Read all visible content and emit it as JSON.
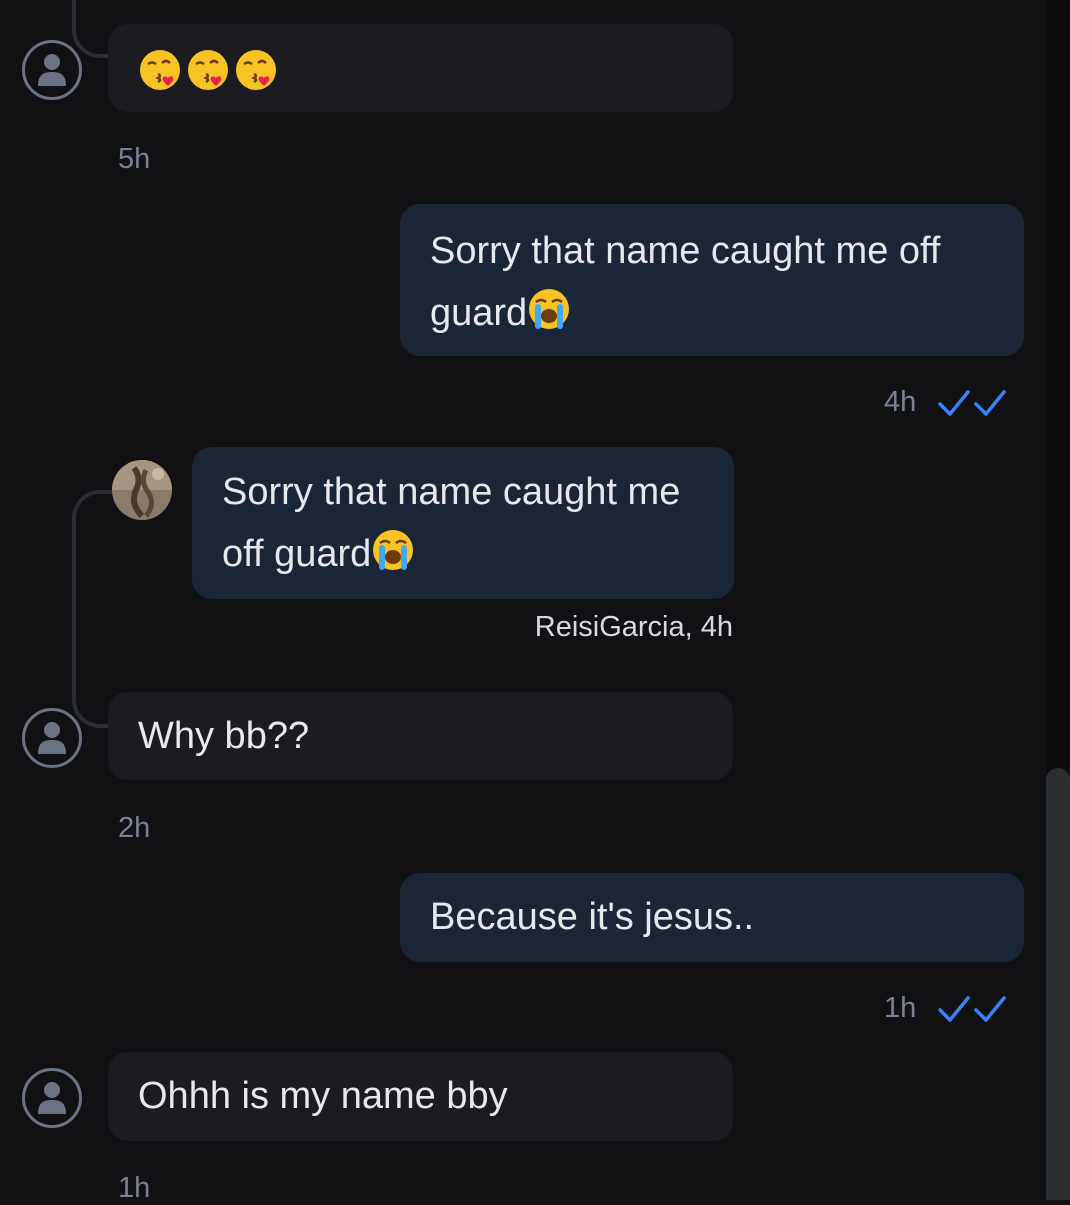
{
  "colors": {
    "background": "#111114",
    "incoming_bubble": "#1b1b20",
    "outgoing_bubble": "#1a2636",
    "read_receipt": "#3b82f6",
    "timestamp": "#7a8395"
  },
  "messages": [
    {
      "direction": "incoming",
      "emoji": [
        "kissing-face-with-heart",
        "kissing-face-with-heart",
        "kissing-face-with-heart"
      ],
      "time": "5h"
    },
    {
      "direction": "outgoing",
      "text": "Sorry that name caught me off\nguard",
      "emoji": "loudly-crying-face",
      "time": "4h",
      "status_icon": "double-check-icon"
    },
    {
      "direction": "quoted-reply",
      "text": "Sorry that name caught me\noff guard",
      "emoji": "loudly-crying-face",
      "attribution": "ReisiGarcia, 4h"
    },
    {
      "direction": "incoming",
      "text": "Why bb??",
      "time": "2h"
    },
    {
      "direction": "outgoing",
      "text": "Because it's jesus..",
      "time": "1h",
      "status_icon": "double-check-icon"
    },
    {
      "direction": "incoming",
      "text": "Ohhh is my name bby",
      "time": "1h"
    }
  ]
}
